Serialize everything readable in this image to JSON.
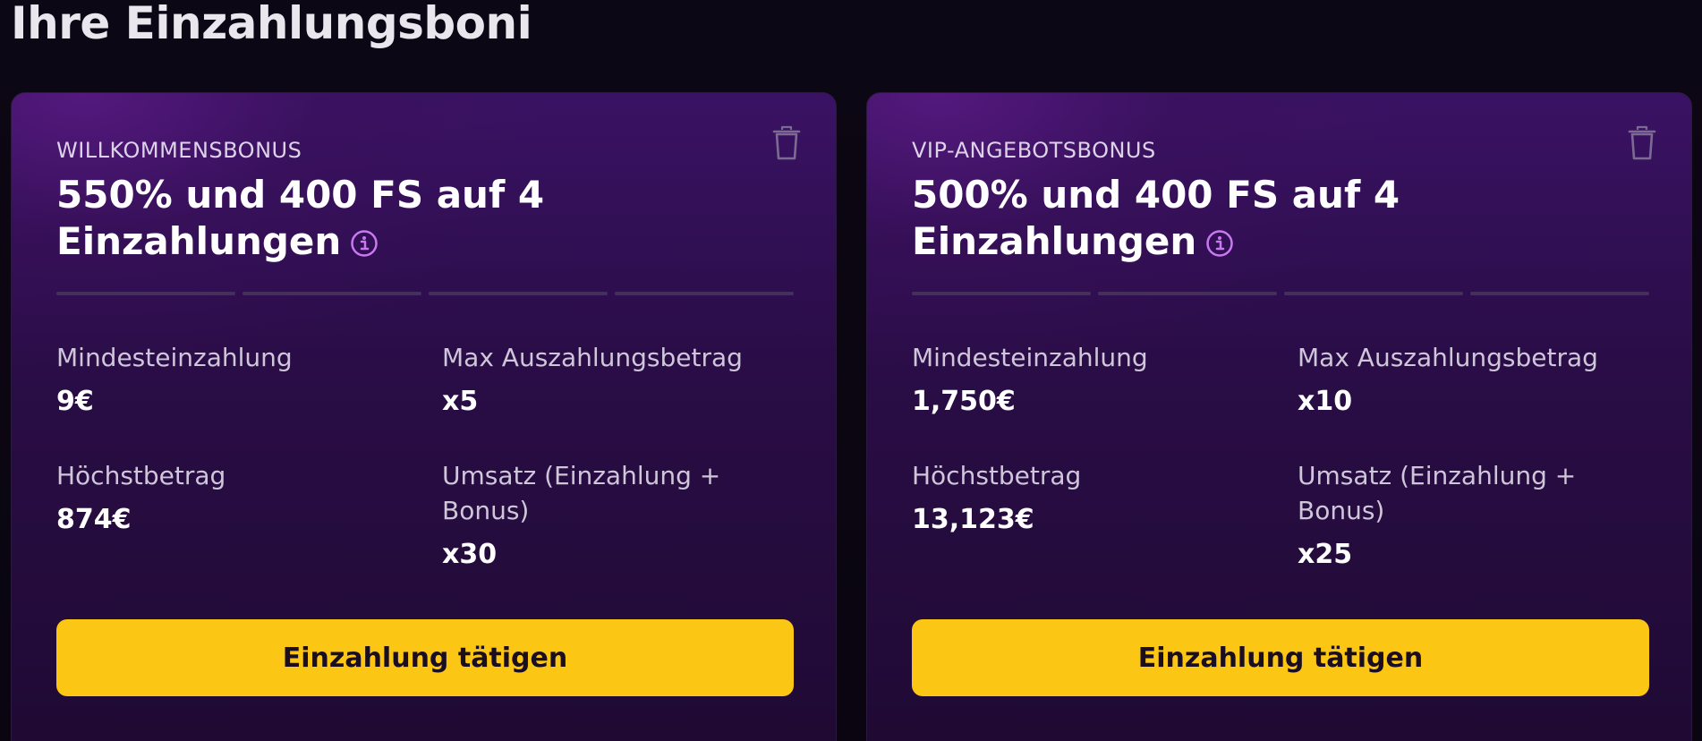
{
  "page": {
    "title": "Ihre Einzahlungsboni"
  },
  "colors": {
    "background": "#0b0612",
    "card_gradient_top": "#3a1264",
    "card_gradient_bottom": "#1f0a33",
    "accent_yellow": "#fcc614",
    "info_icon": "#c979f0",
    "progress_empty": "#45305c"
  },
  "labels": {
    "min_deposit": "Mindesteinzahlung",
    "max_cashout": "Max Auszahlungsbetrag",
    "max_amount": "Höchstbetrag",
    "turnover": "Umsatz (Einzahlung + Bonus)",
    "cta": "Einzahlung tätigen"
  },
  "icons": {
    "delete": "trash-icon",
    "info": "info-icon"
  },
  "bonuses": [
    {
      "type": "WILLKOMMENSBONUS",
      "title": "550% und 400 FS auf 4 Einzahlungen",
      "progress_completed_of_4": 0,
      "min_deposit": "9€",
      "max_cashout": "x5",
      "max_amount": "874€",
      "turnover": "x30"
    },
    {
      "type": "VIP-ANGEBOTSBONUS",
      "title": "500% und 400 FS auf 4 Einzahlungen",
      "progress_completed_of_4": 0,
      "min_deposit": "1,750€",
      "max_cashout": "x10",
      "max_amount": "13,123€",
      "turnover": "x25"
    }
  ]
}
